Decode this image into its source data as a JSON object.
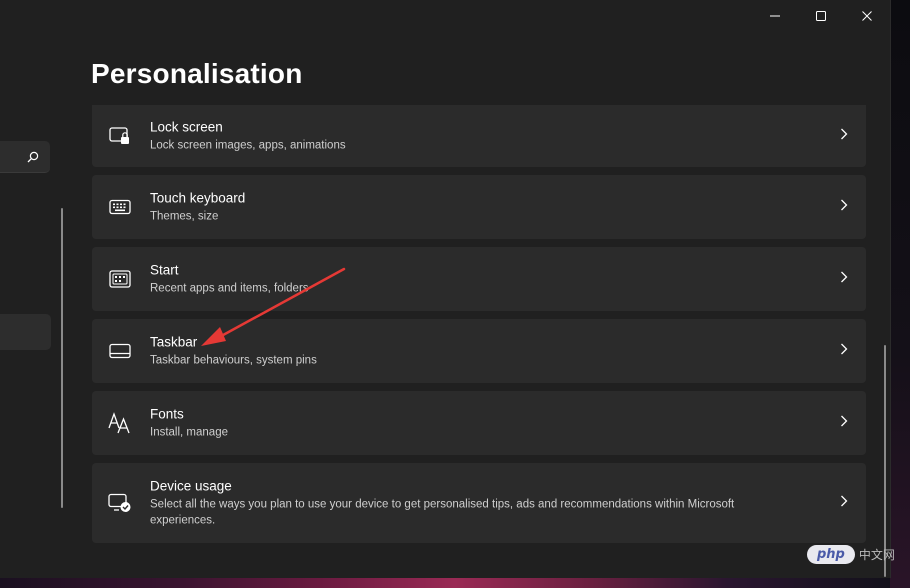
{
  "window": {
    "page_title": "Personalisation",
    "caption_buttons": [
      "minimize-icon",
      "maximize-icon",
      "close-icon"
    ]
  },
  "nav": {
    "search_icon": "search-icon"
  },
  "settings": [
    {
      "title": "Lock screen",
      "subtitle": "Lock screen images, apps, animations",
      "icon": "lock-screen-icon"
    },
    {
      "title": "Touch keyboard",
      "subtitle": "Themes, size",
      "icon": "keyboard-icon"
    },
    {
      "title": "Start",
      "subtitle": "Recent apps and items, folders",
      "icon": "start-icon"
    },
    {
      "title": "Taskbar",
      "subtitle": "Taskbar behaviours, system pins",
      "icon": "taskbar-icon"
    },
    {
      "title": "Fonts",
      "subtitle": "Install, manage",
      "icon": "fonts-icon"
    },
    {
      "title": "Device usage",
      "subtitle": "Select all the ways you plan to use your device to get personalised tips, ads and recommendations within Microsoft experiences.",
      "icon": "device-usage-icon"
    }
  ],
  "annotation": {
    "color": "#e53935"
  },
  "watermark": {
    "logo": "php",
    "text": "中文网"
  }
}
